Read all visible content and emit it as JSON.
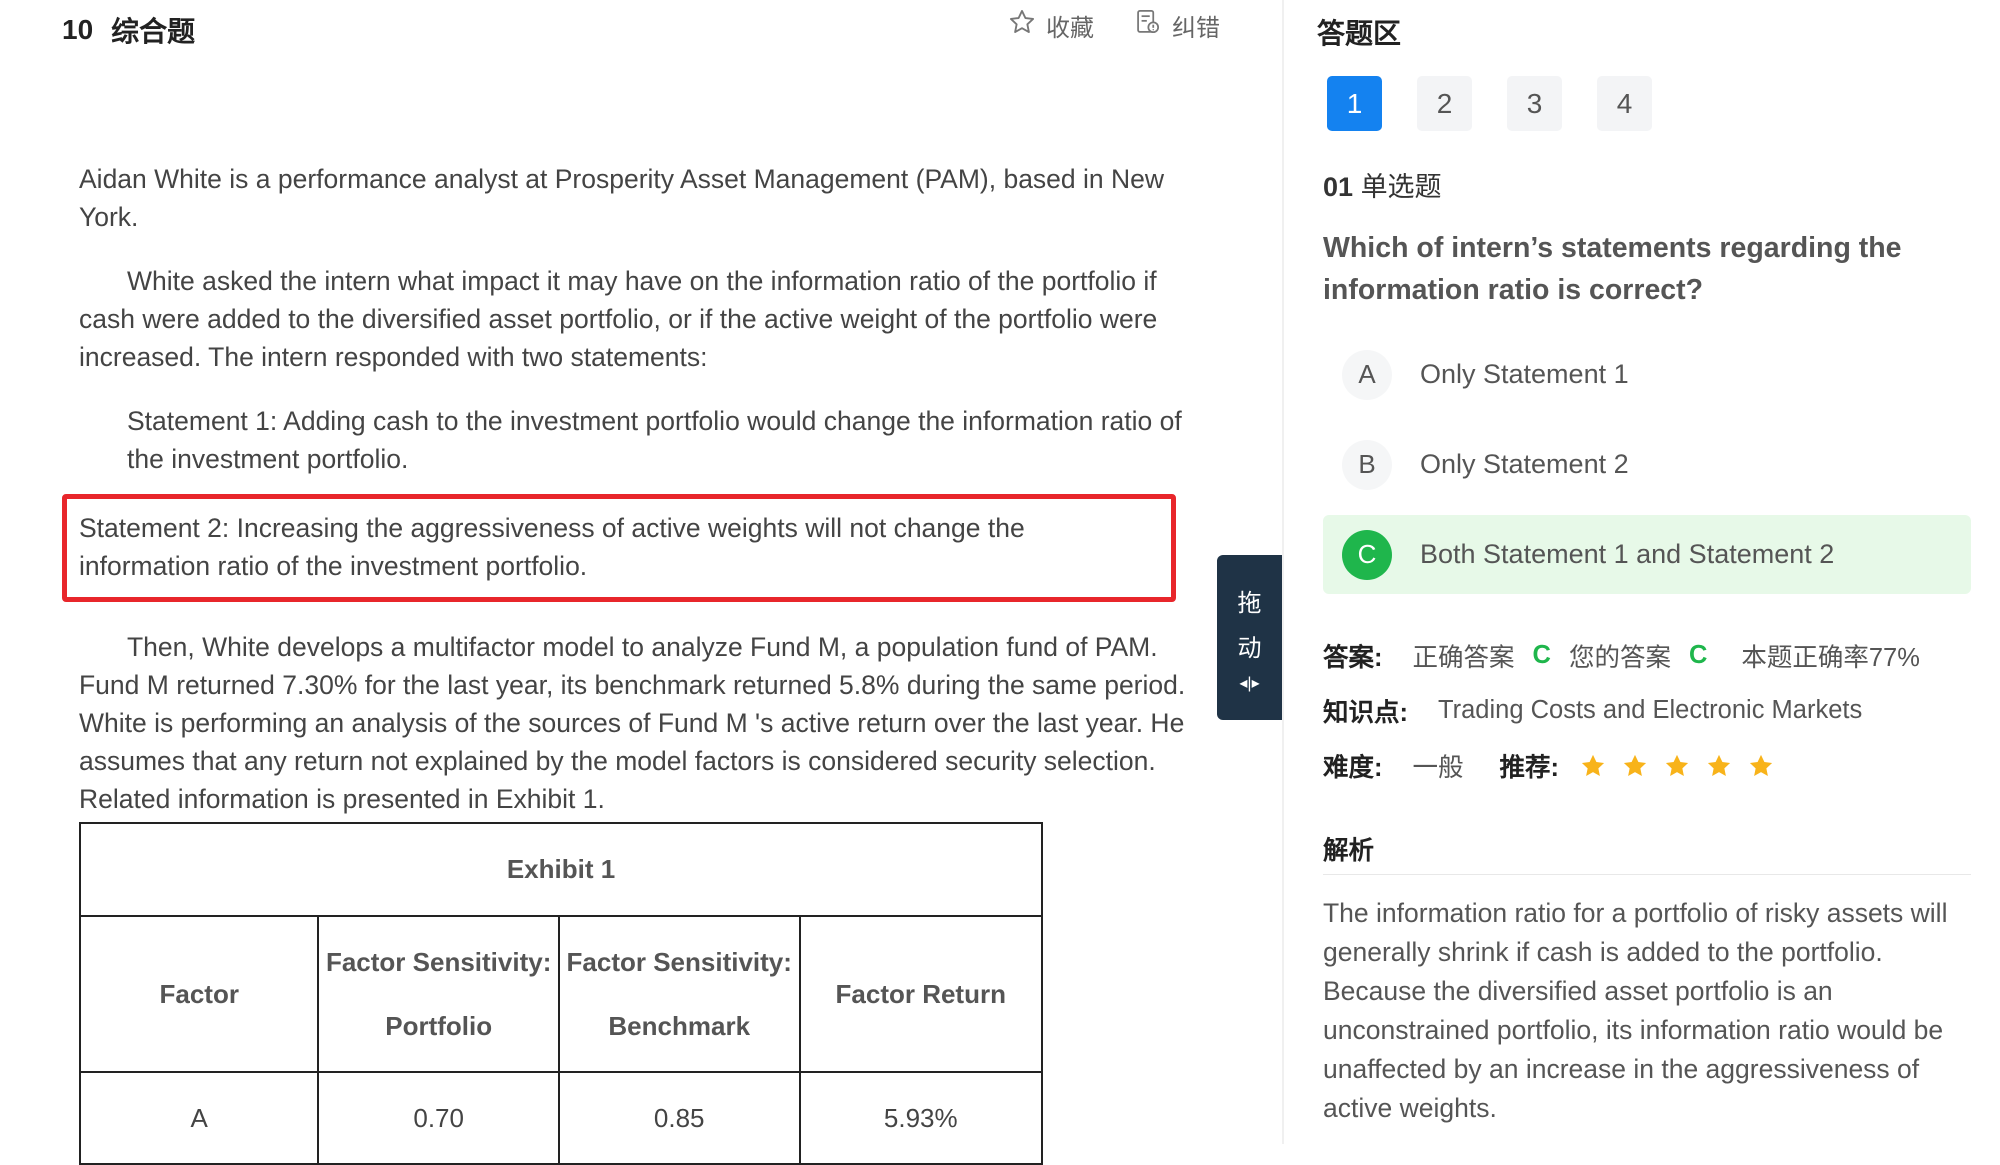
{
  "question": {
    "number": "10",
    "type": "综合题",
    "favorite_label": "收藏",
    "report_label": "纠错"
  },
  "stem": {
    "p1": "Aidan White is a performance analyst at Prosperity Asset Management (PAM), based in New York.",
    "p2": "White asked the intern what impact it may have on the information ratio of the portfolio if cash were added to the diversified asset portfolio, or if the active weight of the portfolio were increased. The intern responded with two statements:",
    "p3": "Statement 1: Adding cash to the investment portfolio would change the information ratio of the investment portfolio.",
    "p4": "Statement 2: Increasing the aggressiveness of active weights will not change the information ratio of the investment portfolio.",
    "p5": "Then, White develops a multifactor model to analyze Fund M, a population fund of PAM. Fund M returned 7.30% for the last year, its benchmark returned 5.8% during the same period. White is performing an analysis of the sources of Fund M 's active return over the last year. He assumes that any return not explained by the model factors is considered security selection. Related information is presented in Exhibit 1."
  },
  "exhibit": {
    "title": "Exhibit 1",
    "headers": [
      "Factor",
      "Factor Sensitivity:",
      "Portfolio",
      "Factor Sensitivity:",
      "Benchmark",
      "Factor Return"
    ],
    "rows": [
      [
        "A",
        "0.70",
        "0.85",
        "5.93%"
      ]
    ]
  },
  "drag": {
    "c1": "拖",
    "c2": "动",
    "c3": "◂|▸"
  },
  "answer_panel": {
    "title": "答题区",
    "numbers": [
      "1",
      "2",
      "3",
      "4"
    ],
    "sub_num": "01",
    "sub_type": "单选题",
    "question": "Which of intern’s statements regarding the information ratio is correct?",
    "options": [
      {
        "letter": "A",
        "text": "Only Statement 1"
      },
      {
        "letter": "B",
        "text": "Only Statement 2"
      },
      {
        "letter": "C",
        "text": "Both Statement 1 and Statement 2"
      }
    ],
    "answer_label": "答案:",
    "correct_label": "正确答案",
    "correct_value": "C",
    "your_label": "您的答案",
    "your_value": "C",
    "rate": "本题正确率77%",
    "knowledge_label": "知识点:",
    "knowledge_value": "Trading Costs and Electronic Markets",
    "difficulty_label": "难度:",
    "difficulty_value": "一般",
    "recommend_label": "推荐:",
    "recommend_stars": 5,
    "analysis_title": "解析",
    "analysis_text": "The information ratio for a portfolio of risky assets will generally shrink if cash is added to the portfolio. Because the diversified asset portfolio is an unconstrained portfolio, its information ratio would be unaffected by an increase in the aggressiveness of active weights."
  },
  "colors": {
    "accent": "#1482f0",
    "correct": "#1fb64c",
    "highlight": "#e8262b",
    "star": "#f8b31a"
  }
}
